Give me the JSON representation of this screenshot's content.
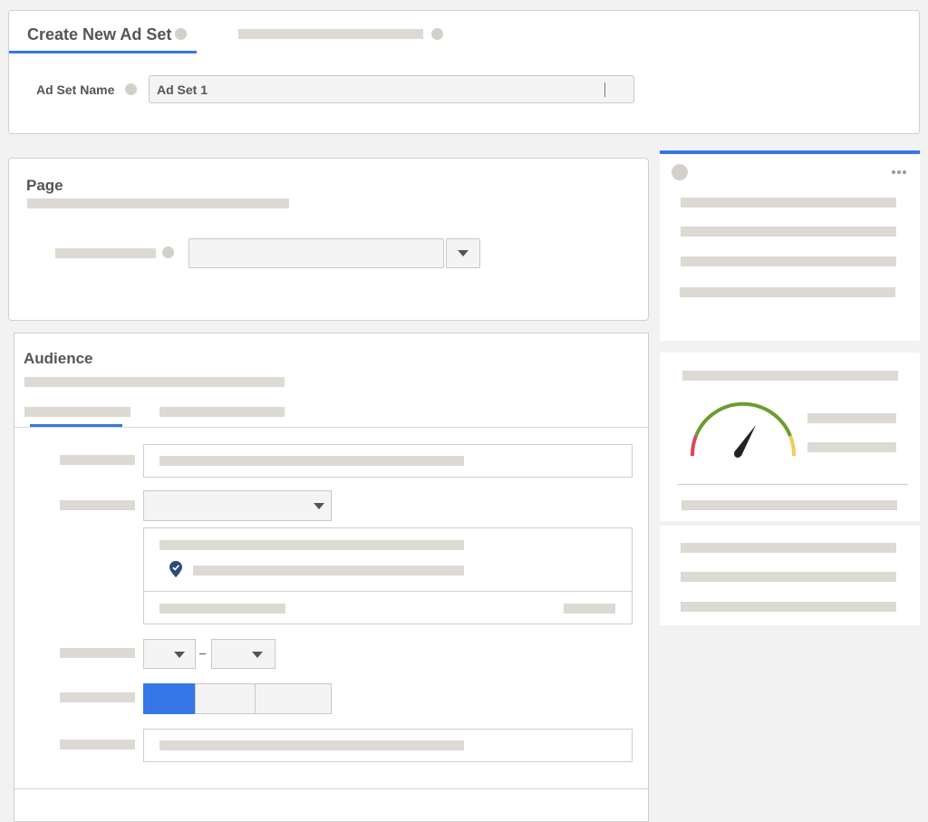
{
  "header": {
    "tab_active_label": "Create New Ad Set",
    "ad_set_name_label": "Ad Set Name",
    "ad_set_name_value": "Ad Set 1"
  },
  "page_section": {
    "title": "Page"
  },
  "audience_section": {
    "title": "Audience"
  },
  "colors": {
    "accent": "#3578e5",
    "gauge_green": "#6a9e2f",
    "gauge_red": "#d9475a",
    "gauge_yellow": "#f0cc55"
  },
  "icons": [
    "info-icon",
    "dropdown-caret-icon",
    "location-pin-icon",
    "more-options-icon",
    "audience-gauge-icon"
  ],
  "gender_selected_index": 0
}
